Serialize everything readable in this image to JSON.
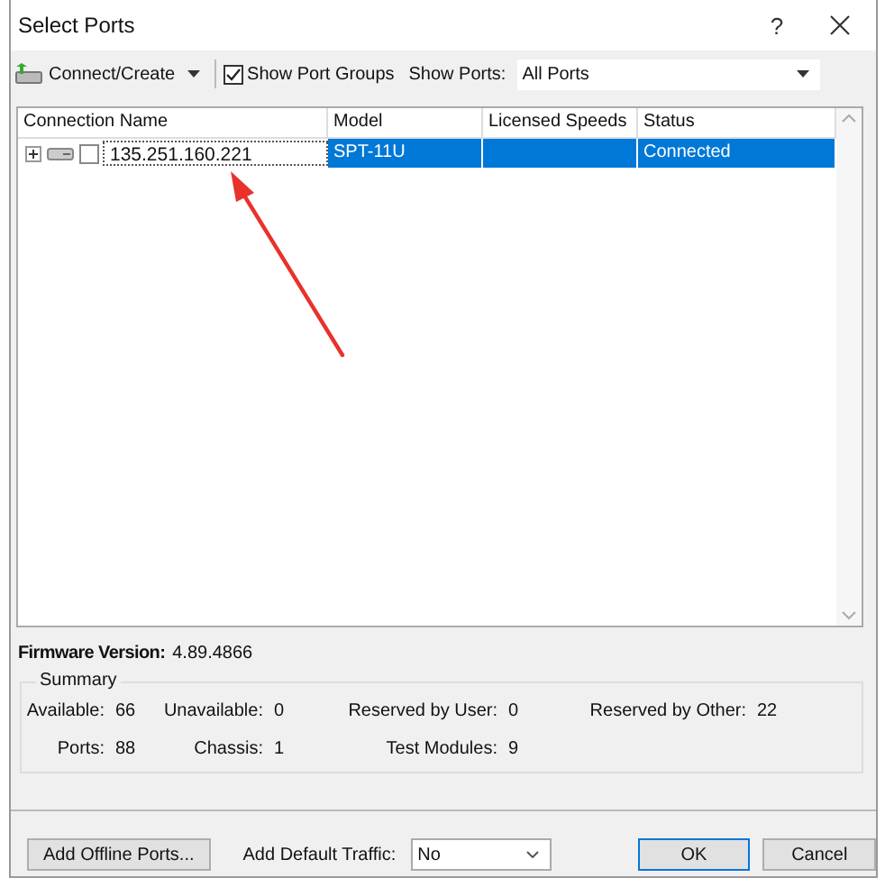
{
  "window": {
    "title": "Select Ports",
    "help": "?"
  },
  "toolbar": {
    "connect_button": "Connect/Create",
    "show_port_groups": {
      "label": "Show Port Groups",
      "checked": true
    },
    "show_ports": {
      "label": "Show Ports:",
      "value": "All Ports"
    }
  },
  "table": {
    "columns": [
      "Connection Name",
      "Model",
      "Licensed Speeds",
      "Status"
    ],
    "rows": [
      {
        "expanded": false,
        "checked": false,
        "connection_name": "135.251.160.221",
        "model": "SPT-11U",
        "status": "Connected",
        "selected": true
      }
    ]
  },
  "firmware": {
    "label": "Firmware Version:",
    "value": "4.89.4866"
  },
  "summary": {
    "title": "Summary",
    "rows": [
      [
        {
          "label": "Available:",
          "value": "66"
        },
        {
          "label": "Unavailable:",
          "value": "0"
        },
        {
          "label": "Reserved by User:",
          "value": "0"
        },
        {
          "label": "Reserved by Other:",
          "value": "22"
        }
      ],
      [
        {
          "label": "Ports:",
          "value": "88"
        },
        {
          "label": "Chassis:",
          "value": "1"
        },
        {
          "label": "Test Modules:",
          "value": "9"
        }
      ]
    ]
  },
  "footer": {
    "add_offline_button": "Add Offline Ports...",
    "default_traffic": {
      "label": "Add Default Traffic:",
      "value": "No"
    },
    "buttons": [
      {
        "label": "OK",
        "default": true
      },
      {
        "label": "Cancel",
        "default": false
      }
    ]
  }
}
